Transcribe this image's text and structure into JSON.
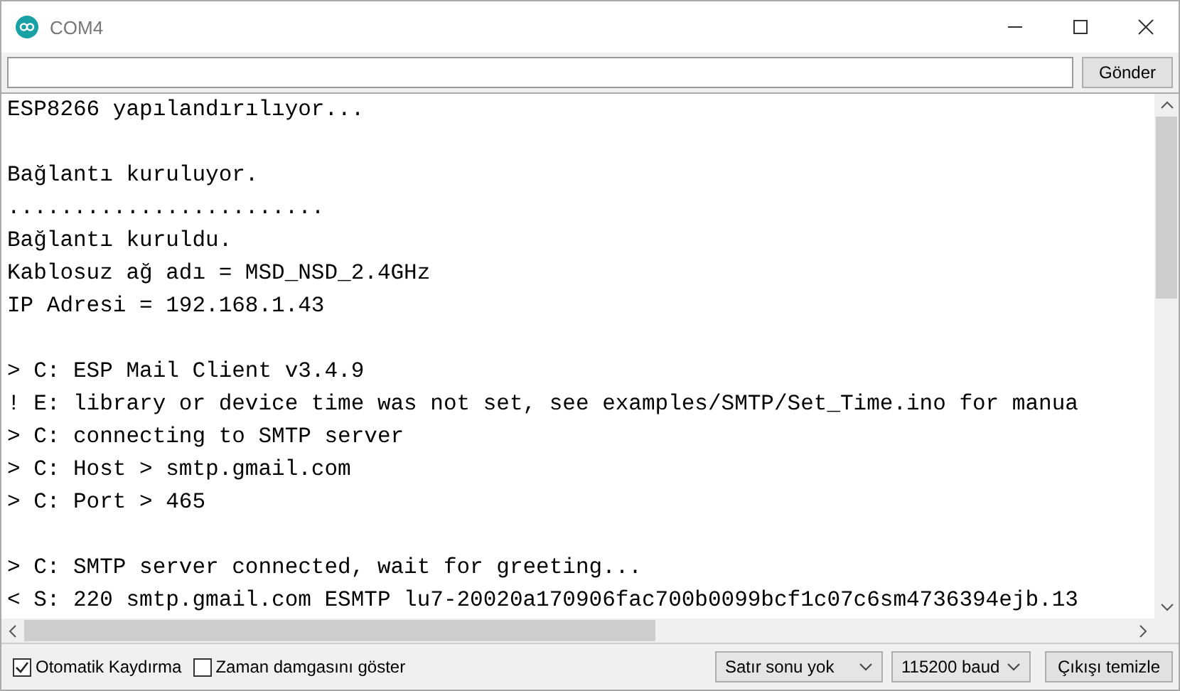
{
  "window": {
    "title": "COM4"
  },
  "input": {
    "send_button": "Gönder"
  },
  "output": [
    {
      "kind": "text",
      "text": "ESP8266 yapılandırılıyor..."
    },
    {
      "kind": "blank"
    },
    {
      "kind": "text",
      "text": "Bağlantı kuruluyor."
    },
    {
      "kind": "text",
      "text": "........................"
    },
    {
      "kind": "text",
      "text": "Bağlantı kuruldu."
    },
    {
      "kind": "text",
      "text": "Kablosuz ağ adı = MSD_NSD_2.4GHz"
    },
    {
      "kind": "text",
      "text": "IP Adresi = 192.168.1.43"
    },
    {
      "kind": "blank"
    },
    {
      "kind": "text",
      "text": "> C: ESP Mail Client v3.4.9"
    },
    {
      "kind": "text",
      "text": "! E: library or device time was not set, see examples/SMTP/Set_Time.ino for manua"
    },
    {
      "kind": "text",
      "text": "> C: connecting to SMTP server"
    },
    {
      "kind": "text",
      "text": "> C: Host > smtp.gmail.com"
    },
    {
      "kind": "text",
      "text": "> C: Port > 465"
    },
    {
      "kind": "blank"
    },
    {
      "kind": "text",
      "text": "> C: SMTP server connected, wait for greeting..."
    },
    {
      "kind": "text",
      "text": "< S: 220 smtp.gmail.com ESMTP lu7-20020a170906fac700b0099bcf1c07c6sm4736394ejb.13"
    }
  ],
  "footer": {
    "autoscroll": {
      "label": "Otomatik Kaydırma",
      "checked": true
    },
    "timestamp": {
      "label": "Zaman damgasını göster",
      "checked": false
    },
    "line_ending": "Satır sonu yok",
    "baud": "115200 baud",
    "clear_button": "Çıkışı temizle"
  }
}
